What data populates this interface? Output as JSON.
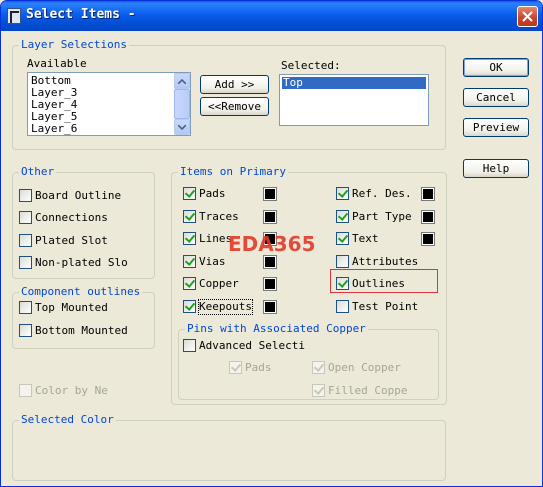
{
  "window": {
    "title": "Select Items -"
  },
  "layer_selections": {
    "title": "Layer Selections",
    "available_label": "Available",
    "available_items": [
      "Bottom",
      "Layer_3",
      "Layer_4",
      "Layer_5",
      "Layer_6"
    ],
    "selected_label": "Selected:",
    "selected_items": [
      "Top"
    ],
    "add_label": "Add >>",
    "remove_label": "<<Remove"
  },
  "buttons": {
    "ok": "OK",
    "cancel": "Cancel",
    "preview": "Preview",
    "help": "Help"
  },
  "other": {
    "title": "Other",
    "items": [
      {
        "label": "Board Outline",
        "checked": false
      },
      {
        "label": "Connections",
        "checked": false
      },
      {
        "label": "Plated Slot",
        "checked": false
      },
      {
        "label": "Non-plated Slo",
        "checked": false
      }
    ]
  },
  "component_outlines": {
    "title": "Component outlines",
    "items": [
      {
        "label": "Top Mounted",
        "checked": false
      },
      {
        "label": "Bottom Mounted",
        "checked": false
      }
    ]
  },
  "color_by_net": {
    "label": "Color by Ne",
    "checked": false,
    "enabled": false
  },
  "items_on_primary": {
    "title": "Items on Primary",
    "left": [
      {
        "label": "Pads",
        "checked": true
      },
      {
        "label": "Traces",
        "checked": true
      },
      {
        "label": "Lines",
        "checked": true
      },
      {
        "label": "Vias",
        "checked": true
      },
      {
        "label": "Copper",
        "checked": true
      },
      {
        "label": "Keepouts",
        "checked": true
      }
    ],
    "right": [
      {
        "label": "Ref. Des.",
        "checked": true
      },
      {
        "label": "Part Type",
        "checked": true
      },
      {
        "label": "Text",
        "checked": true
      },
      {
        "label": "Attributes",
        "checked": false
      },
      {
        "label": "Outlines",
        "checked": true
      },
      {
        "label": "Test Point",
        "checked": false
      }
    ],
    "swatch_color": "#000000"
  },
  "pins_with_copper": {
    "title": "Pins with Associated Copper",
    "advanced_label": "Advanced Selection",
    "pads_label": "Pads",
    "open_copper_label": "Open Copper",
    "filled_copper_label": "Filled Coppe"
  },
  "selected_color": {
    "title": "Selected Color"
  },
  "watermark": "EDA365",
  "colors": {
    "group_title": "#0046d5",
    "titlebar": "#0b5ded",
    "highlight": "#d9363e"
  }
}
